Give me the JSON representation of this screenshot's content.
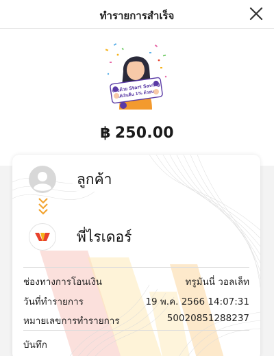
{
  "header": {
    "title": "ทำรายการสำเร็จ",
    "close_icon": "close-icon"
  },
  "promo": {
    "badge_line1": "จ่ายด้วย Start Saving",
    "badge_line2": "ได้เงินคืน 1% ด้วยนะ",
    "illustration_icon": "promo-girl-illustration"
  },
  "amount": {
    "currency": "฿",
    "value": "250.00"
  },
  "transfer": {
    "from_name": "ลูกค้า",
    "from_icon": "user-avatar-icon",
    "arrow_icon": "chevron-double-down-icon",
    "to_name": "พี่ไรเดอร์",
    "to_icon": "rider-logo-icon"
  },
  "details": {
    "rows": [
      {
        "label": "ช่องทางการโอนเงิน",
        "value": "ทรูมันนี่ วอลเล็ท"
      },
      {
        "label": "วันที่ทำรายการ",
        "value": "19 พ.ค. 2566 14:07:31"
      },
      {
        "label": "หมายเลขการทำรายการ",
        "value": "50020851288237"
      }
    ],
    "note_label": "บันทึก"
  },
  "colors": {
    "arrow": "#f2a431",
    "rider_logo_red": "#e8412c",
    "rider_logo_yellow": "#f6b21a",
    "avatar_grey": "#d8d8d8"
  }
}
